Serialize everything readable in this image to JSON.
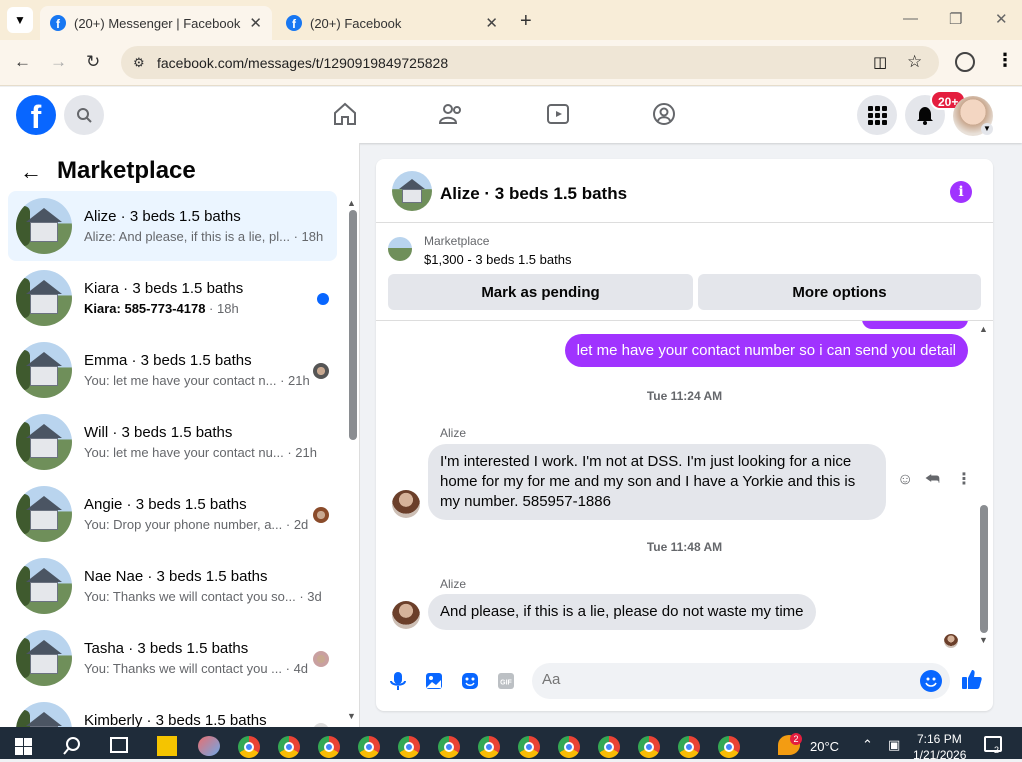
{
  "browser": {
    "tabs": [
      {
        "title": "(20+) Messenger | Facebook",
        "active": true
      },
      {
        "title": "(20+) Facebook",
        "active": false
      }
    ],
    "url": "facebook.com/messages/t/1290919849725828"
  },
  "fb_nav": {
    "notification_badge": "20+"
  },
  "left_panel": {
    "title": "Marketplace",
    "conversations": [
      {
        "name": "Alize · 3 beds 1.5 baths",
        "preview": "Alize: And please, if this is a lie, pl...",
        "time": "· 18h",
        "selected": true,
        "unread": false
      },
      {
        "name": "Kiara · 3 beds 1.5 baths",
        "preview": "Kiara: 585-773-4178",
        "time": "· 18h",
        "selected": false,
        "unread": true
      },
      {
        "name": "Emma · 3 beds 1.5 baths",
        "preview": "You: let me have your contact n...",
        "time": "· 21h",
        "selected": false,
        "unread": false
      },
      {
        "name": "Will · 3 beds 1.5 baths",
        "preview": "You: let me have your contact nu...",
        "time": "· 21h",
        "selected": false,
        "unread": false
      },
      {
        "name": "Angie · 3 beds 1.5 baths",
        "preview": "You: Drop your phone number, a...",
        "time": "· 2d",
        "selected": false,
        "unread": false
      },
      {
        "name": "Nae Nae · 3 beds 1.5 baths",
        "preview": "You: Thanks we will contact you so...",
        "time": "· 3d",
        "selected": false,
        "unread": false
      },
      {
        "name": "Tasha · 3 beds 1.5 baths",
        "preview": "You: Thanks we will contact you ...",
        "time": "· 4d",
        "selected": false,
        "unread": false
      },
      {
        "name": "Kimberly · 3 beds 1.5 baths",
        "preview": "",
        "time": "",
        "selected": false,
        "unread": false
      }
    ]
  },
  "chat": {
    "title": "Alize · 3 beds 1.5 baths",
    "marketplace_label": "Marketplace",
    "listing": "$1,300 - 3 beds 1.5 baths",
    "buttons": {
      "pending": "Mark as pending",
      "more": "More options"
    },
    "messages": {
      "outgoing_1": "let me have your contact number so i can send you detail",
      "time_1": "Tue 11:24 AM",
      "sender_1": "Alize",
      "incoming_1": "I'm interested I work. I'm not at DSS. I'm just looking for a nice home for my for me and my son and I have a Yorkie and this is my number. 585957-1886",
      "time_2": "Tue 11:48 AM",
      "sender_2": "Alize",
      "incoming_2": "And please, if this is a lie, please do not waste my time"
    },
    "composer_placeholder": "Aa"
  },
  "taskbar": {
    "weather": "20°C",
    "weather_badge": "2",
    "time": "7:16 PM",
    "date": "1/21/2026",
    "notif_count": "2"
  },
  "colors": {
    "fb_blue": "#0866ff",
    "messenger_purple": "#a033ff",
    "selected_bg": "#ebf5ff",
    "badge_red": "#e41e3f"
  }
}
